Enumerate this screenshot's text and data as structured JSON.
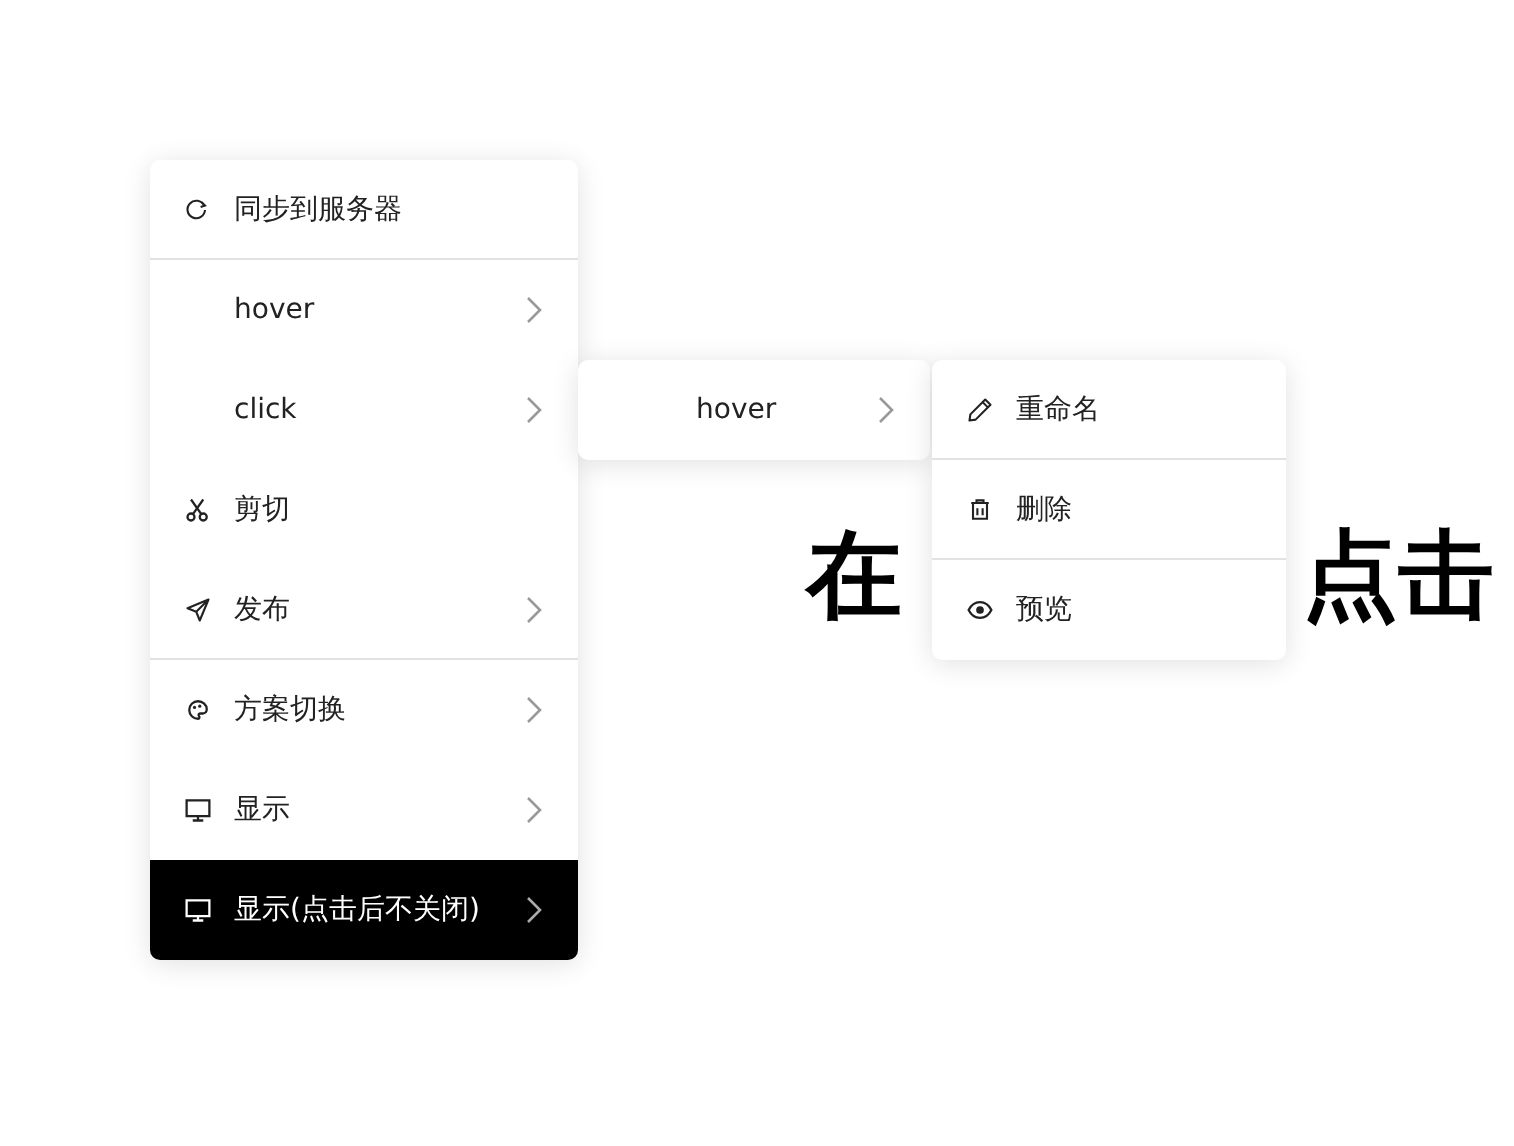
{
  "heading": {
    "parts": [
      "在",
      "点击"
    ]
  },
  "menu": {
    "items": [
      {
        "label": "同步到服务器",
        "kind": "sync",
        "submenu": false,
        "selected": false,
        "divider_after": true
      },
      {
        "label": "hover",
        "submenu": true,
        "selected": false,
        "divider_after": false
      },
      {
        "label": "click",
        "submenu": true,
        "selected": false,
        "divider_after": false
      },
      {
        "label": "剪切",
        "kind": "scissors",
        "submenu": false,
        "selected": false,
        "divider_after": false
      },
      {
        "label": "发布",
        "kind": "send",
        "submenu": true,
        "selected": false,
        "divider_after": true
      },
      {
        "label": "方案切换",
        "kind": "palette",
        "submenu": true,
        "selected": false,
        "divider_after": false
      },
      {
        "label": "显示",
        "kind": "monitor",
        "submenu": true,
        "selected": false,
        "divider_after": false
      },
      {
        "label": "显示(点击后不关闭)",
        "kind": "monitor",
        "submenu": true,
        "selected": true,
        "divider_after": false
      }
    ]
  },
  "submenu": {
    "items": [
      {
        "label": "hover",
        "submenu": true,
        "selected": false,
        "divider_after": false
      }
    ]
  },
  "submenu_2": {
    "items": [
      {
        "label": "重命名",
        "kind": "pencil",
        "submenu": false,
        "selected": false,
        "divider_after": true
      },
      {
        "label": "删除",
        "kind": "trash",
        "submenu": false,
        "selected": false,
        "divider_after": true
      },
      {
        "label": "预览",
        "kind": "eye",
        "submenu": false,
        "selected": false,
        "divider_after": false
      }
    ]
  }
}
